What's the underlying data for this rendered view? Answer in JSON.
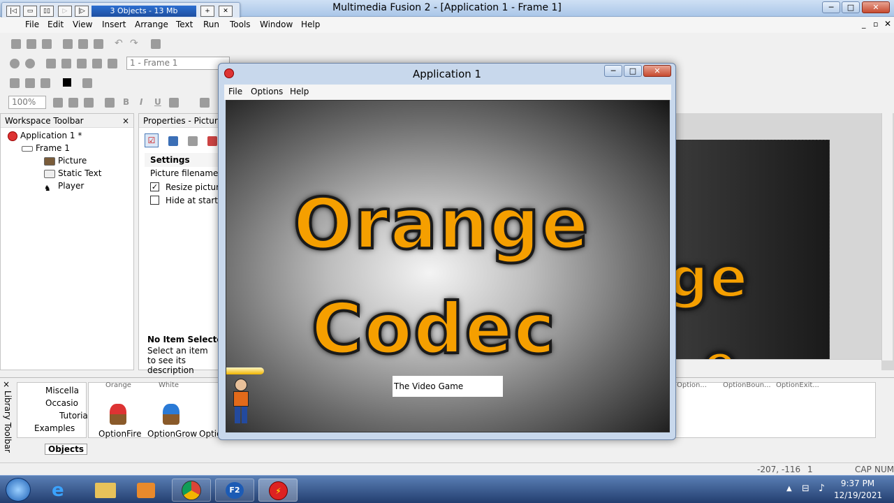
{
  "window": {
    "title": "Multimedia Fusion 2 - [Application 1 - Frame 1]",
    "min": "─",
    "max": "□",
    "close": "✕"
  },
  "mediabar": {
    "status": "3 Objects - 13 Mb",
    "buttons": [
      "|◁",
      "▭",
      "▯▯",
      "▷",
      "|▷"
    ],
    "add": "+",
    "close": "✕"
  },
  "menu": [
    "File",
    "Edit",
    "View",
    "Insert",
    "Arrange",
    "Text",
    "Run",
    "Tools",
    "Window",
    "Help"
  ],
  "toolbar": {
    "frame_select": "1 - Frame 1",
    "zoom": "100%",
    "bold": "B",
    "italic": "I",
    "underline": "U"
  },
  "workspace": {
    "title": "Workspace Toolbar",
    "close": "×",
    "tree": [
      {
        "label": "Application 1 *",
        "level": 0
      },
      {
        "label": "Frame 1",
        "level": 1
      },
      {
        "label": "Picture",
        "level": 2
      },
      {
        "label": "Static Text",
        "level": 2
      },
      {
        "label": "Player",
        "level": 2
      }
    ]
  },
  "properties": {
    "title": "Properties - Picture",
    "section": "Settings",
    "rows": [
      {
        "label": "Picture filename",
        "checkbox": false
      },
      {
        "label": "Resize picture",
        "checkbox": true,
        "checked": true
      },
      {
        "label": "Hide at start",
        "checkbox": true,
        "checked": false
      }
    ],
    "no_item_title": "No Item Selected",
    "no_item_desc": "Select an item to see its description"
  },
  "app_window": {
    "title": "Application 1",
    "menu": [
      "File",
      "Options",
      "Help"
    ],
    "game_line1": "Orange",
    "game_line2": "Codec",
    "textbox": "The Video Game",
    "editor_text1": "ge",
    "editor_text2": "e"
  },
  "library": {
    "title": "Library Toolbar",
    "tree": [
      "Miscella",
      "Occasio",
      "Tutorial",
      "Examples"
    ],
    "tab": "Objects",
    "items": [
      "OptionFire",
      "OptionGrow",
      "Optio"
    ],
    "top_labels": [
      "Orange",
      "White"
    ],
    "right_labels": [
      "Option...",
      "OptionBoun...",
      "OptionExit..."
    ]
  },
  "statusbar": {
    "coords": "-207, -116",
    "frame": "1",
    "caps": "CAP",
    "num": "NUM"
  },
  "taskbar": {
    "time": "9:37 PM",
    "date": "12/19/2021"
  }
}
